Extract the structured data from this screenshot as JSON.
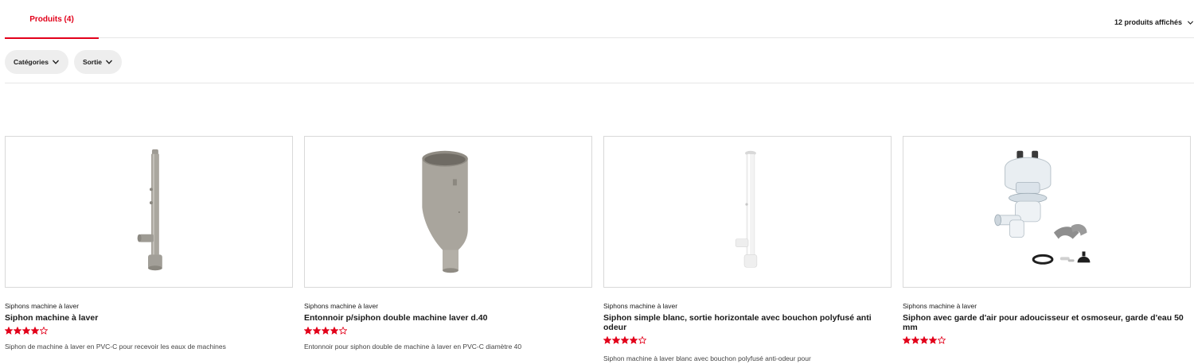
{
  "tabs": {
    "active_label": "Produits (4)"
  },
  "display": {
    "count_label": "12 produits affichés",
    "icon": "chevron-down-icon"
  },
  "filters": [
    {
      "label": "Catégories",
      "icon": "chevron-down-icon"
    },
    {
      "label": "Sortie",
      "icon": "chevron-down-icon"
    }
  ],
  "colors": {
    "accent": "#e2001a",
    "product_grey": "#a8a59e",
    "product_white": "#f2f2f2"
  },
  "products": [
    {
      "category": "Siphons machine à laver",
      "title": "Siphon machine à laver",
      "rating": 4,
      "rating_max": 5,
      "description": "Siphon de machine à laver en PVC-C pour recevoir les eaux de machines",
      "image_icon": "grey-siphon-pipe-image"
    },
    {
      "category": "Siphons machine à laver",
      "title": "Entonnoir p/siphon double machine laver d.40",
      "rating": 4,
      "rating_max": 5,
      "description": "Entonnoir pour siphon double de machine à laver en PVC-C diamètre 40",
      "image_icon": "grey-funnel-image"
    },
    {
      "category": "Siphons machine à laver",
      "title": "Siphon simple blanc, sortie horizontale avec bouchon polyfusé anti odeur",
      "rating": 4,
      "rating_max": 5,
      "description": "Siphon machine à laver blanc avec bouchon polyfusé anti-odeur pour",
      "image_icon": "white-siphon-pipe-image"
    },
    {
      "category": "Siphons machine à laver",
      "title": "Siphon avec garde d'air pour adoucisseur et osmoseur, garde d'eau 50 mm",
      "rating": 4,
      "rating_max": 5,
      "description": "",
      "image_icon": "siphon-kit-image"
    }
  ]
}
